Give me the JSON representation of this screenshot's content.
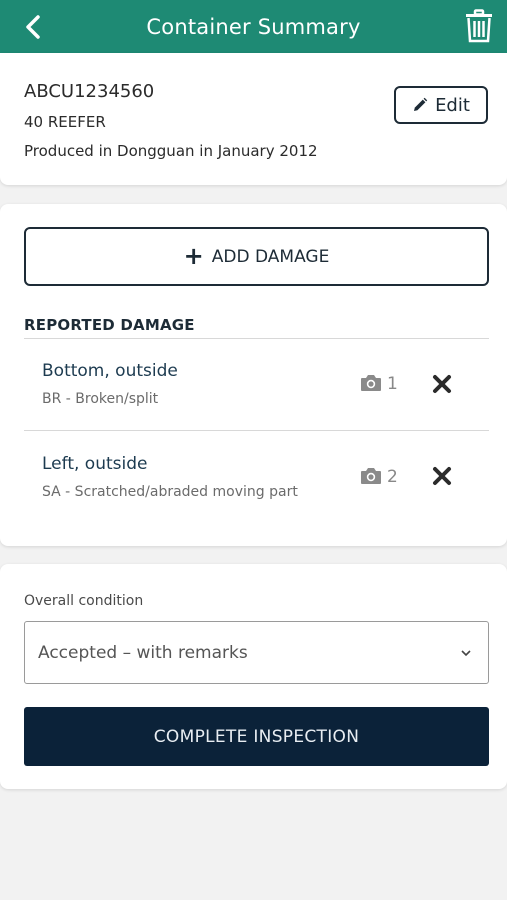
{
  "header": {
    "title": "Container Summary",
    "back_icon": "chevron-left-icon",
    "delete_icon": "trash-icon"
  },
  "container": {
    "id": "ABCU1234560",
    "type": "40 REEFER",
    "produced": "Produced in Dongguan in January 2012",
    "edit_label": "Edit"
  },
  "damage": {
    "add_label": "ADD DAMAGE",
    "section_title": "REPORTED DAMAGE",
    "items": [
      {
        "location": "Bottom, outside",
        "code": "BR - Broken/split",
        "photos": "1"
      },
      {
        "location": "Left, outside",
        "code": "SA - Scratched/abraded moving part",
        "photos": "2"
      }
    ]
  },
  "condition": {
    "label": "Overall condition",
    "selected": "Accepted – with remarks"
  },
  "actions": {
    "complete_label": "COMPLETE INSPECTION"
  },
  "colors": {
    "header": "#1e8a74",
    "primary": "#0b2239",
    "background": "#f2f2f2"
  }
}
